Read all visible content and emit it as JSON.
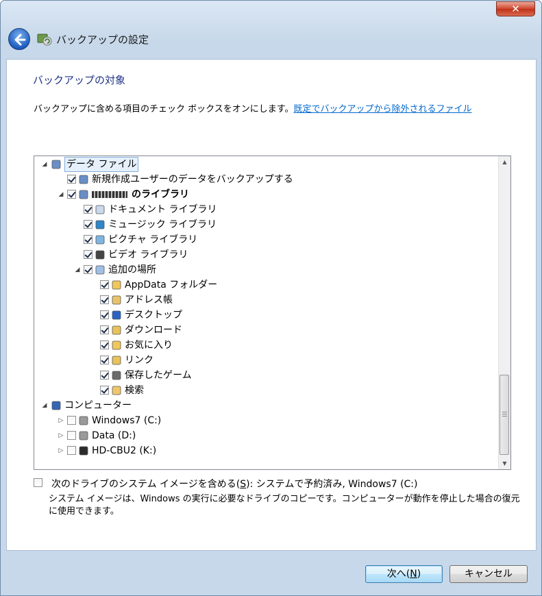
{
  "window": {
    "title": "バックアップの設定",
    "close_label": "✕"
  },
  "content": {
    "heading": "バックアップの対象",
    "instruction": "バックアップに含める項目のチェック ボックスをオンにします。",
    "link": "既定でバックアップから除外されるファイル"
  },
  "tree": {
    "items": [
      {
        "label": "データ ファイル",
        "expander": "◢",
        "checkbox": null,
        "icon": "users-icon",
        "selected": true
      },
      {
        "label": "新規作成ユーザーのデータをバックアップする",
        "expander": "",
        "checkbox": true,
        "icon": "users-icon"
      },
      {
        "label": "のライブラリ",
        "expander": "◢",
        "checkbox": true,
        "icon": "users-icon",
        "bold": true
      },
      {
        "label": "ドキュメント ライブラリ",
        "expander": "",
        "checkbox": true,
        "icon": "documents-library-icon"
      },
      {
        "label": "ミュージック ライブラリ",
        "expander": "",
        "checkbox": true,
        "icon": "music-library-icon"
      },
      {
        "label": "ピクチャ ライブラリ",
        "expander": "",
        "checkbox": true,
        "icon": "pictures-library-icon"
      },
      {
        "label": "ビデオ ライブラリ",
        "expander": "",
        "checkbox": true,
        "icon": "videos-library-icon"
      },
      {
        "label": "追加の場所",
        "expander": "◢",
        "checkbox": true,
        "icon": "additional-locations-icon"
      },
      {
        "label": "AppData フォルダー",
        "expander": "",
        "checkbox": true,
        "icon": "folder-icon"
      },
      {
        "label": "アドレス帳",
        "expander": "",
        "checkbox": true,
        "icon": "contacts-icon"
      },
      {
        "label": "デスクトップ",
        "expander": "",
        "checkbox": true,
        "icon": "desktop-icon"
      },
      {
        "label": "ダウンロード",
        "expander": "",
        "checkbox": true,
        "icon": "downloads-icon"
      },
      {
        "label": "お気に入り",
        "expander": "",
        "checkbox": true,
        "icon": "favorites-icon"
      },
      {
        "label": "リンク",
        "expander": "",
        "checkbox": true,
        "icon": "links-icon"
      },
      {
        "label": "保存したゲーム",
        "expander": "",
        "checkbox": true,
        "icon": "saved-games-icon"
      },
      {
        "label": "検索",
        "expander": "",
        "checkbox": true,
        "icon": "searches-icon"
      },
      {
        "label": "コンピューター",
        "expander": "◢",
        "checkbox": null,
        "icon": "computer-icon"
      },
      {
        "label": "Windows7 (C:)",
        "expander": "▷",
        "checkbox": false,
        "icon": "drive-icon"
      },
      {
        "label": "Data (D:)",
        "expander": "▷",
        "checkbox": false,
        "icon": "drive-icon"
      },
      {
        "label": "HD-CBU2 (K:)",
        "expander": "▷",
        "checkbox": false,
        "icon": "external-drive-icon"
      }
    ]
  },
  "system_image": {
    "checked": false,
    "option_pre": "次のドライブのシステム イメージを含める(",
    "option_key": "S",
    "option_post": "): システムで予約済み, Windows7 (C:)",
    "description": "システム イメージは、Windows の実行に必要なドライブのコピーです。コンピューターが動作を停止した場合の復元に使用できます。"
  },
  "buttons": {
    "next_pre": "次へ(",
    "next_key": "N",
    "next_post": ")",
    "cancel": "キャンセル"
  },
  "colors": {
    "heading": "#1e3287",
    "link": "#0066cc",
    "chrome": "#c7d8ea"
  }
}
